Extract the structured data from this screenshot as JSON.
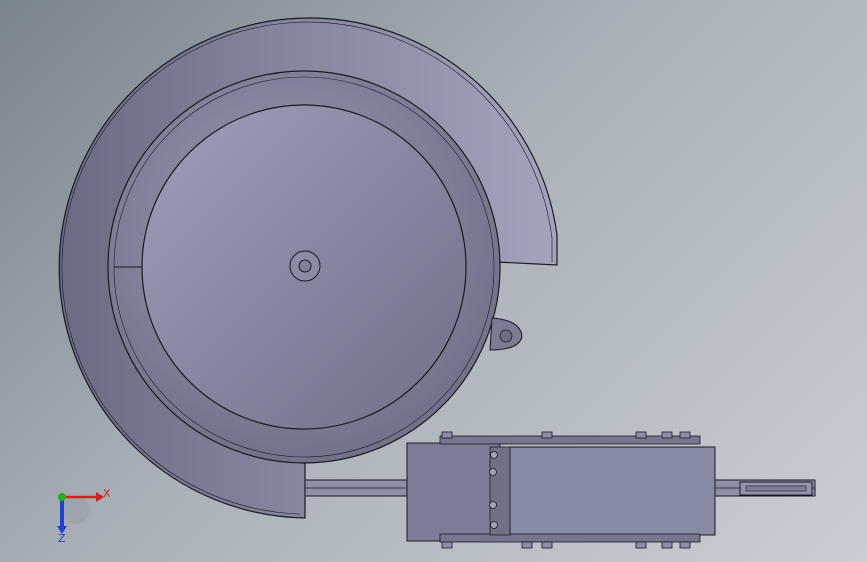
{
  "viewport": {
    "background_top": "#7a838e",
    "background_bottom": "#c9ced4",
    "model_fill": "#787a93",
    "model_fill_light": "#9c9eb8",
    "model_stroke": "#1a1a22"
  },
  "triad": {
    "x_label": "X",
    "z_label": "Z",
    "x_color": "#d42020",
    "y_color": "#20b020",
    "z_color": "#2040d0"
  }
}
